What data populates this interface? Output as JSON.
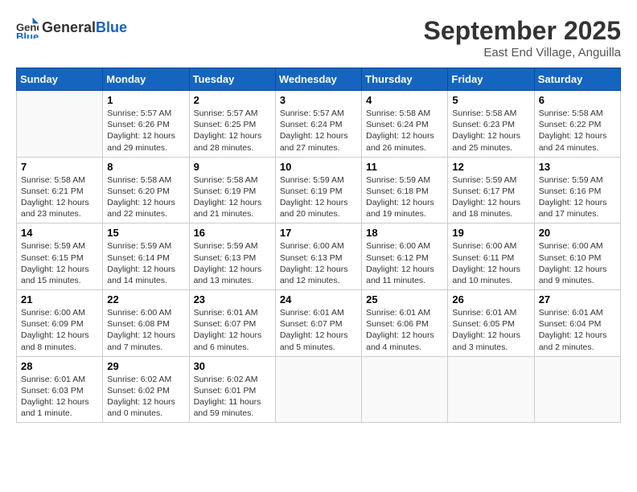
{
  "header": {
    "logo_general": "General",
    "logo_blue": "Blue",
    "month": "September 2025",
    "location": "East End Village, Anguilla"
  },
  "days_of_week": [
    "Sunday",
    "Monday",
    "Tuesday",
    "Wednesday",
    "Thursday",
    "Friday",
    "Saturday"
  ],
  "weeks": [
    [
      {
        "num": "",
        "info": ""
      },
      {
        "num": "1",
        "info": "Sunrise: 5:57 AM\nSunset: 6:26 PM\nDaylight: 12 hours\nand 29 minutes."
      },
      {
        "num": "2",
        "info": "Sunrise: 5:57 AM\nSunset: 6:25 PM\nDaylight: 12 hours\nand 28 minutes."
      },
      {
        "num": "3",
        "info": "Sunrise: 5:57 AM\nSunset: 6:24 PM\nDaylight: 12 hours\nand 27 minutes."
      },
      {
        "num": "4",
        "info": "Sunrise: 5:58 AM\nSunset: 6:24 PM\nDaylight: 12 hours\nand 26 minutes."
      },
      {
        "num": "5",
        "info": "Sunrise: 5:58 AM\nSunset: 6:23 PM\nDaylight: 12 hours\nand 25 minutes."
      },
      {
        "num": "6",
        "info": "Sunrise: 5:58 AM\nSunset: 6:22 PM\nDaylight: 12 hours\nand 24 minutes."
      }
    ],
    [
      {
        "num": "7",
        "info": "Sunrise: 5:58 AM\nSunset: 6:21 PM\nDaylight: 12 hours\nand 23 minutes."
      },
      {
        "num": "8",
        "info": "Sunrise: 5:58 AM\nSunset: 6:20 PM\nDaylight: 12 hours\nand 22 minutes."
      },
      {
        "num": "9",
        "info": "Sunrise: 5:58 AM\nSunset: 6:19 PM\nDaylight: 12 hours\nand 21 minutes."
      },
      {
        "num": "10",
        "info": "Sunrise: 5:59 AM\nSunset: 6:19 PM\nDaylight: 12 hours\nand 20 minutes."
      },
      {
        "num": "11",
        "info": "Sunrise: 5:59 AM\nSunset: 6:18 PM\nDaylight: 12 hours\nand 19 minutes."
      },
      {
        "num": "12",
        "info": "Sunrise: 5:59 AM\nSunset: 6:17 PM\nDaylight: 12 hours\nand 18 minutes."
      },
      {
        "num": "13",
        "info": "Sunrise: 5:59 AM\nSunset: 6:16 PM\nDaylight: 12 hours\nand 17 minutes."
      }
    ],
    [
      {
        "num": "14",
        "info": "Sunrise: 5:59 AM\nSunset: 6:15 PM\nDaylight: 12 hours\nand 15 minutes."
      },
      {
        "num": "15",
        "info": "Sunrise: 5:59 AM\nSunset: 6:14 PM\nDaylight: 12 hours\nand 14 minutes."
      },
      {
        "num": "16",
        "info": "Sunrise: 5:59 AM\nSunset: 6:13 PM\nDaylight: 12 hours\nand 13 minutes."
      },
      {
        "num": "17",
        "info": "Sunrise: 6:00 AM\nSunset: 6:13 PM\nDaylight: 12 hours\nand 12 minutes."
      },
      {
        "num": "18",
        "info": "Sunrise: 6:00 AM\nSunset: 6:12 PM\nDaylight: 12 hours\nand 11 minutes."
      },
      {
        "num": "19",
        "info": "Sunrise: 6:00 AM\nSunset: 6:11 PM\nDaylight: 12 hours\nand 10 minutes."
      },
      {
        "num": "20",
        "info": "Sunrise: 6:00 AM\nSunset: 6:10 PM\nDaylight: 12 hours\nand 9 minutes."
      }
    ],
    [
      {
        "num": "21",
        "info": "Sunrise: 6:00 AM\nSunset: 6:09 PM\nDaylight: 12 hours\nand 8 minutes."
      },
      {
        "num": "22",
        "info": "Sunrise: 6:00 AM\nSunset: 6:08 PM\nDaylight: 12 hours\nand 7 minutes."
      },
      {
        "num": "23",
        "info": "Sunrise: 6:01 AM\nSunset: 6:07 PM\nDaylight: 12 hours\nand 6 minutes."
      },
      {
        "num": "24",
        "info": "Sunrise: 6:01 AM\nSunset: 6:07 PM\nDaylight: 12 hours\nand 5 minutes."
      },
      {
        "num": "25",
        "info": "Sunrise: 6:01 AM\nSunset: 6:06 PM\nDaylight: 12 hours\nand 4 minutes."
      },
      {
        "num": "26",
        "info": "Sunrise: 6:01 AM\nSunset: 6:05 PM\nDaylight: 12 hours\nand 3 minutes."
      },
      {
        "num": "27",
        "info": "Sunrise: 6:01 AM\nSunset: 6:04 PM\nDaylight: 12 hours\nand 2 minutes."
      }
    ],
    [
      {
        "num": "28",
        "info": "Sunrise: 6:01 AM\nSunset: 6:03 PM\nDaylight: 12 hours\nand 1 minute."
      },
      {
        "num": "29",
        "info": "Sunrise: 6:02 AM\nSunset: 6:02 PM\nDaylight: 12 hours\nand 0 minutes."
      },
      {
        "num": "30",
        "info": "Sunrise: 6:02 AM\nSunset: 6:01 PM\nDaylight: 11 hours\nand 59 minutes."
      },
      {
        "num": "",
        "info": ""
      },
      {
        "num": "",
        "info": ""
      },
      {
        "num": "",
        "info": ""
      },
      {
        "num": "",
        "info": ""
      }
    ]
  ]
}
